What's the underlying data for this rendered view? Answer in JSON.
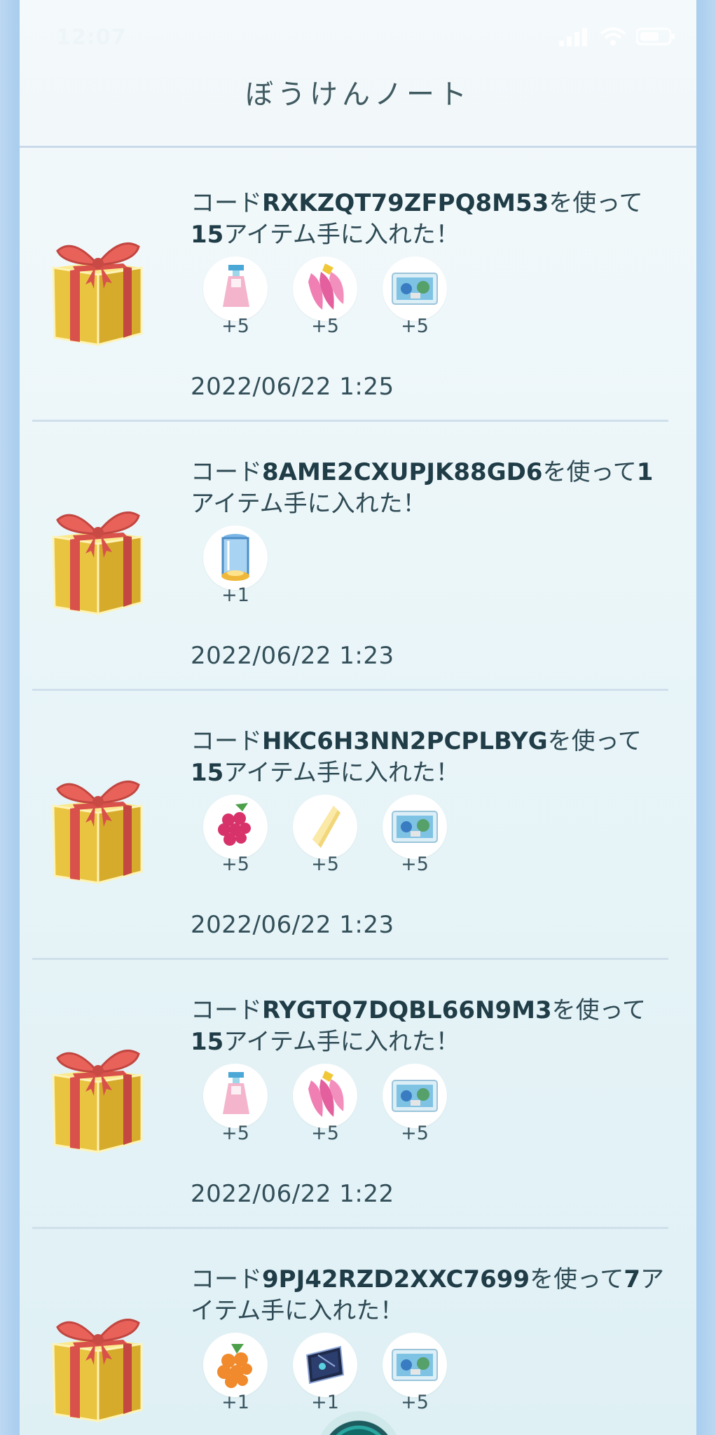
{
  "status_bar": {
    "time": "12:07"
  },
  "header": {
    "title": "ぼうけんノート"
  },
  "entries": [
    {
      "prefix": "コード",
      "code": "RXKZQT79ZFPQ8M53",
      "mid": "を使って",
      "count": "15",
      "suffix": "アイテム手に入れた！",
      "items": [
        {
          "icon": "spray-potion-icon",
          "qty": "+5"
        },
        {
          "icon": "pinap-berry-icon",
          "qty": "+5"
        },
        {
          "icon": "sticker-icon",
          "qty": "+5"
        }
      ],
      "date": "2022/06/22 1:25"
    },
    {
      "prefix": "コード",
      "code": "8AME2CXUPJK88GD6",
      "mid": "を使って",
      "count": "1",
      "suffix": "アイテム手に入れた！",
      "items": [
        {
          "icon": "incubator-icon",
          "qty": "+1"
        }
      ],
      "date": "2022/06/22 1:23"
    },
    {
      "prefix": "コード",
      "code": "HKC6H3NN2PCPLBYG",
      "mid": "を使って",
      "count": "15",
      "suffix": "アイテム手に入れた！",
      "items": [
        {
          "icon": "razz-berry-icon",
          "qty": "+5"
        },
        {
          "icon": "stardust-piece-icon",
          "qty": "+5"
        },
        {
          "icon": "sticker-icon",
          "qty": "+5"
        }
      ],
      "date": "2022/06/22 1:23"
    },
    {
      "prefix": "コード",
      "code": "RYGTQ7DQBL66N9M3",
      "mid": "を使っ",
      "count_prefix": "て",
      "count": "15",
      "suffix": "アイテム手に入れた！",
      "items": [
        {
          "icon": "spray-potion-icon",
          "qty": "+5"
        },
        {
          "icon": "pinap-berry-icon",
          "qty": "+5"
        },
        {
          "icon": "sticker-icon",
          "qty": "+5"
        }
      ],
      "date": "2022/06/22 1:22"
    },
    {
      "prefix": "コード",
      "code": "9PJ42RZD2XXC7699",
      "mid": "を使って",
      "count": "7",
      "suffix": "アイテム手に入れた！",
      "items": [
        {
          "icon": "golden-berry-icon",
          "qty": "+1"
        },
        {
          "icon": "map-card-icon",
          "qty": "+1"
        },
        {
          "icon": "sticker-icon",
          "qty": "+5"
        }
      ],
      "date": ""
    }
  ]
}
